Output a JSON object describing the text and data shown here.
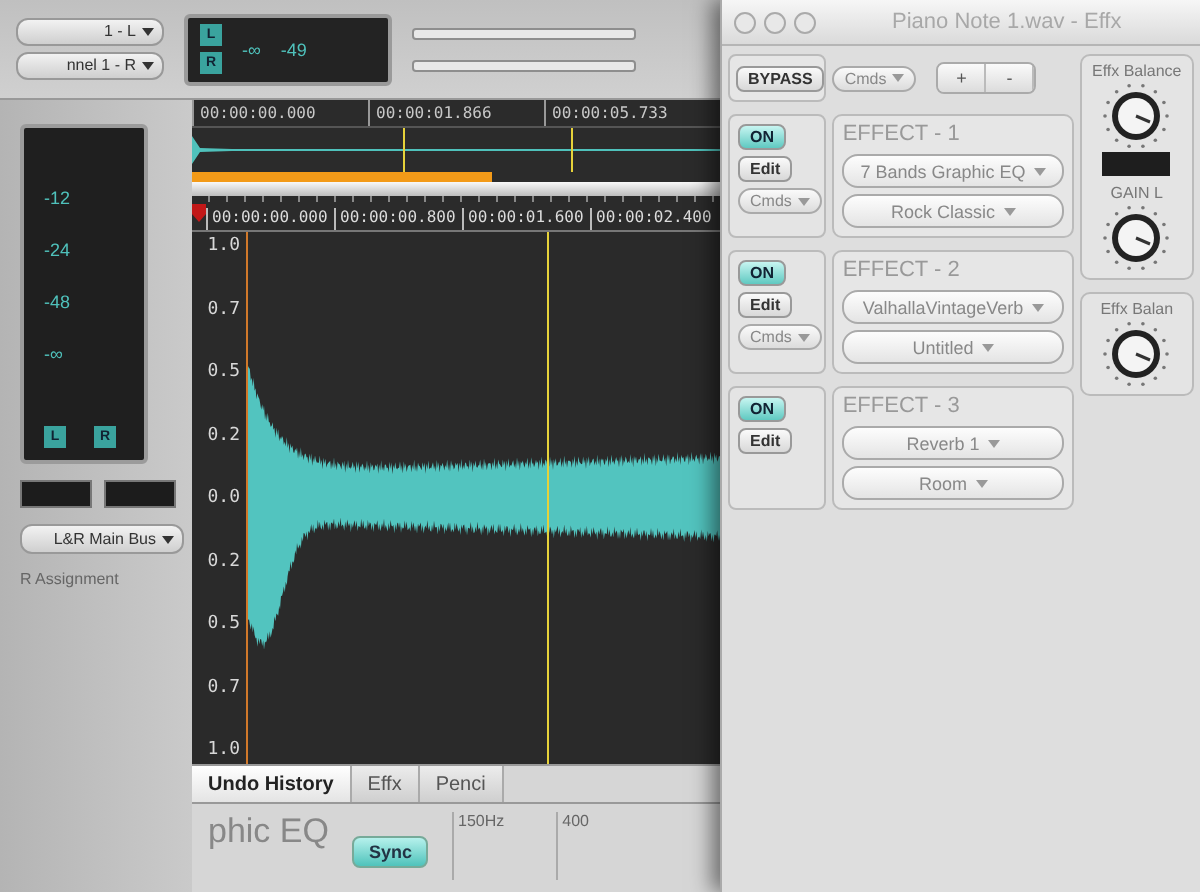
{
  "editor": {
    "mixer": {
      "dropdowns": [
        "1 - L",
        "nnel 1 - R"
      ],
      "meter": {
        "channels": [
          "L",
          "R"
        ],
        "labels": [
          "-∞",
          "-49"
        ]
      }
    },
    "overview": {
      "times": [
        "00:00:00.000",
        "00:00:01.866",
        "00:00:05.733"
      ]
    },
    "ruler": {
      "times": [
        "00:00:00.000",
        "00:00:00.800",
        "00:00:01.600",
        "00:00:02.400"
      ]
    },
    "amplitude_labels": [
      "1.0",
      "0.7",
      "0.5",
      "0.2",
      "0.0",
      "0.2",
      "0.5",
      "0.7",
      "1.0"
    ],
    "meters": {
      "scale": [
        "-12",
        "-24",
        "-48",
        "-∞"
      ],
      "channels": [
        "L",
        "R"
      ],
      "bus": "L&R Main Bus",
      "assignment": "R Assignment"
    }
  },
  "history_panel": {
    "tabs": [
      {
        "label": "Undo History",
        "selected": true
      },
      {
        "label": "Effx",
        "selected": false
      },
      {
        "label": "Penci",
        "selected": false
      }
    ],
    "heading": "phic EQ",
    "sync": {
      "label": "Sync",
      "on": true
    },
    "freq_labels": [
      "150Hz",
      "400"
    ]
  },
  "effects_window": {
    "title": "Piano Note 1.wav - Effx",
    "bypass": "BYPASS",
    "cmds": "Cmds",
    "add": "+",
    "remove": "-",
    "effects": [
      {
        "label": "EFFECT - 1",
        "plugin": "7 Bands Graphic EQ",
        "preset": "Rock Classic",
        "on": true,
        "on_label": "ON",
        "edit": "Edit",
        "cmds": "Cmds"
      },
      {
        "label": "EFFECT - 2",
        "plugin": "ValhallaVintageVerb",
        "preset": "Untitled",
        "on": true,
        "on_label": "ON",
        "edit": "Edit",
        "cmds": "Cmds"
      },
      {
        "label": "EFFECT - 3",
        "plugin": "Reverb 1",
        "preset": "Room",
        "on": true,
        "on_label": "ON",
        "edit": "Edit"
      }
    ],
    "knobs": [
      {
        "label": "Effx Balance"
      },
      {
        "label": "GAIN L"
      },
      {
        "label": "Effx Balan"
      }
    ]
  }
}
